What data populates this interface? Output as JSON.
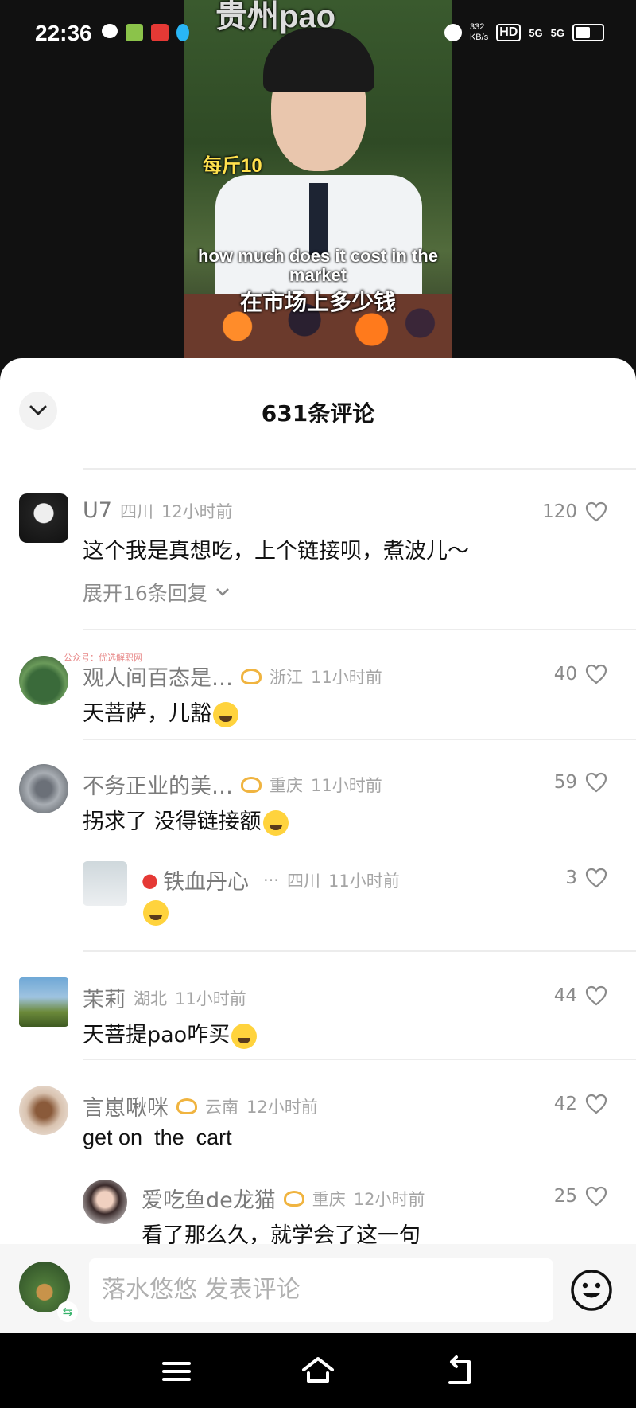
{
  "status_bar": {
    "time": "22:36",
    "net_speed": "332\nKB/s",
    "hd": "HD",
    "signal1": "5G",
    "signal2": "5G"
  },
  "video": {
    "title": "贵州pao",
    "price_tag": "每斤10",
    "caption_en": "how much does it cost in the market",
    "caption_zh": "在市场上多少钱"
  },
  "sheet": {
    "title": "631条评论"
  },
  "comments": [
    {
      "name": "U7",
      "location": "四川",
      "time": "12小时前",
      "text": "这个我是真想吃，上个链接呗，煮波儿～",
      "likes": "120",
      "expand": "展开16条回复"
    },
    {
      "name": "观人间百态是…",
      "location": "浙江",
      "time": "11小时前",
      "text": "天菩萨，儿豁",
      "likes": "40",
      "watermark": "公众号：优选解职网"
    },
    {
      "name": "不务正业的美…",
      "location": "重庆",
      "time": "11小时前",
      "text": "拐求了 没得链接额",
      "likes": "59"
    },
    {
      "name": "铁血丹心",
      "location": "四川",
      "time": "11小时前",
      "text": "",
      "likes": "3",
      "reply": true
    },
    {
      "name": "茉莉",
      "location": "湖北",
      "time": "11小时前",
      "text": "天菩提pao咋买",
      "likes": "44"
    },
    {
      "name": "言崽啾咪",
      "location": "云南",
      "time": "12小时前",
      "text": "get on  the  cart",
      "likes": "42"
    },
    {
      "name": "爱吃鱼de龙猫",
      "location": "重庆",
      "time": "12小时前",
      "text": "看了那么久，就学会了这一句",
      "likes": "25",
      "reply": true
    }
  ],
  "input": {
    "placeholder": "落水悠悠 发表评论"
  },
  "icons": [
    "chevron-down-icon",
    "heart-icon",
    "smile-emoji-icon",
    "menu-icon",
    "home-icon",
    "back-icon",
    "sync-icon"
  ]
}
